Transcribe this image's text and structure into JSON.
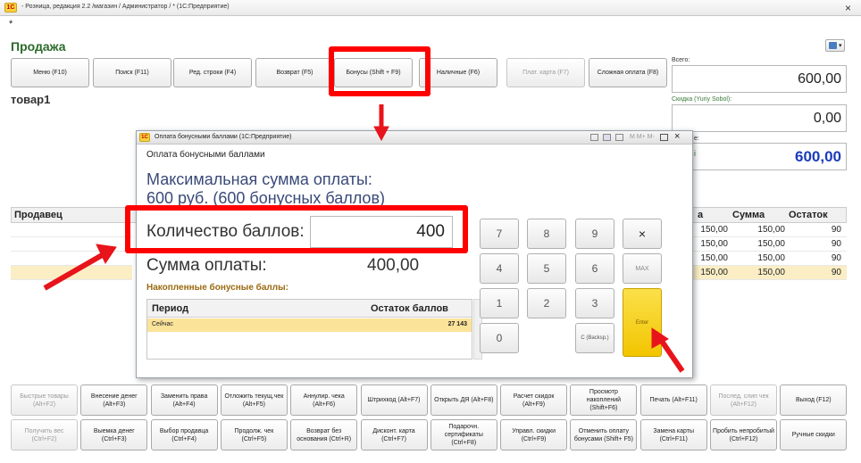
{
  "window": {
    "title": "- Розница, редакция 2.2 /магазин / Администратор / * (1С:Предприятие)",
    "close": "×",
    "star": "*"
  },
  "header": {
    "title": "Продажа",
    "item": "товар1"
  },
  "toolbar": [
    {
      "label": "Меню (F10)",
      "disabled": false
    },
    {
      "label": "Поиск (F11)",
      "disabled": false
    },
    {
      "label": "Ред. строки (F4)",
      "disabled": false
    },
    {
      "label": "Возврат (F5)",
      "disabled": false
    },
    {
      "label": "Бонусы (Shift + F9)",
      "disabled": false
    },
    {
      "label": "Наличные (F6)",
      "disabled": false
    },
    {
      "label": "Плат. карта (F7)",
      "disabled": true
    },
    {
      "label": "Сложная оплата (F8)",
      "disabled": false
    }
  ],
  "totals": {
    "total_label": "Всего:",
    "total_value": "600,00",
    "discount_label": "Скидка (Yuriy Sobol):",
    "discount_value": "0,00",
    "pay_value": "600,00",
    "pay_label_tail": "е:"
  },
  "table": {
    "seller_header": "Продавец",
    "columns": [
      "а",
      "Сумма",
      "Остаток"
    ],
    "rows": [
      {
        "price": "150,00",
        "sum": "150,00",
        "rest": "90"
      },
      {
        "price": "150,00",
        "sum": "150,00",
        "rest": "90"
      },
      {
        "price": "150,00",
        "sum": "150,00",
        "rest": "90"
      },
      {
        "price": "150,00",
        "sum": "150,00",
        "rest": "90"
      }
    ]
  },
  "dialog": {
    "title": "Оплата бонусными баллами (1С:Предприятие)",
    "toolbar_tail": "M M+ M-",
    "heading": "Оплата бонусными баллами",
    "max_line1": "Максимальная сумма оплаты:",
    "max_line2": "600 руб. (600 бонусных баллов)",
    "qty_label": "Количество баллов:",
    "qty_value": "400",
    "sum_label": "Сумма оплаты:",
    "sum_value": "400,00",
    "acc_label": "Накопленные бонусные баллы:",
    "acc_col1": "Период",
    "acc_col2": "Остаток баллов",
    "acc_period": "Сейчас",
    "acc_rest": "27 143",
    "keys": {
      "k7": "7",
      "k8": "8",
      "k9": "9",
      "kx": "×",
      "k4": "4",
      "k5": "5",
      "k6": "6",
      "kmax": "MAX",
      "k1": "1",
      "k2": "2",
      "k3": "3",
      "k0": "0",
      "kc": "C (Backsp.)",
      "kenter": "Enter"
    }
  },
  "bottom_row1": [
    {
      "label": "Быстрые товары (Alt+F2)",
      "disabled": true
    },
    {
      "label": "Внесение денег (Alt+F3)",
      "disabled": false
    },
    {
      "label": "Заменить права (Alt+F4)",
      "disabled": false
    },
    {
      "label": "Отложить текущ.чек (Alt+F5)",
      "disabled": false
    },
    {
      "label": "Аннулир. чека (Alt+F6)",
      "disabled": false
    },
    {
      "label": "Штрихкод (Alt+F7)",
      "disabled": false
    },
    {
      "label": "Открыть ДЯ (Alt+F8)",
      "disabled": false
    },
    {
      "label": "Расчет скидок (Alt+F9)",
      "disabled": false
    },
    {
      "label": "Просмотр накоплений (Shift+F6)",
      "disabled": false
    },
    {
      "label": "Печать (Alt+F11)",
      "disabled": false
    },
    {
      "label": "Послед. слип чек (Alt+F12)",
      "disabled": true
    },
    {
      "label": "Выход (F12)",
      "disabled": false
    }
  ],
  "bottom_row2": [
    {
      "label": "Получить вес (Ctrl+F2)",
      "disabled": true
    },
    {
      "label": "Выемка денег (Ctrl+F3)",
      "disabled": false
    },
    {
      "label": "Выбор продавца (Ctrl+F4)",
      "disabled": false
    },
    {
      "label": "Продолж. чек (Ctrl+F5)",
      "disabled": false
    },
    {
      "label": "Возврат без основания (Ctrl+R)",
      "disabled": false
    },
    {
      "label": "Дисконт. карта (Ctrl+F7)",
      "disabled": false
    },
    {
      "label": "Подарочн. сертификаты (Ctrl+F8)",
      "disabled": false
    },
    {
      "label": "Управл. скидки (Ctrl+F9)",
      "disabled": false
    },
    {
      "label": "Отменить оплату бонусами (Shift+ F5)",
      "disabled": false
    },
    {
      "label": "Замена карты (Ctrl+F11)",
      "disabled": false
    },
    {
      "label": "Пробить непробитый (Ctrl+F12)",
      "disabled": false
    },
    {
      "label": "Ручные скидки",
      "disabled": false
    }
  ]
}
